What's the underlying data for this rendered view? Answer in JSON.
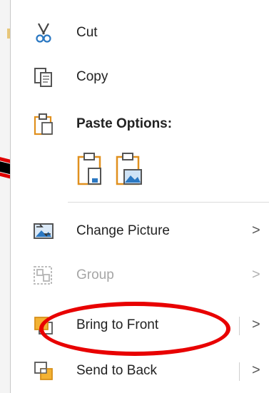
{
  "menu": {
    "cut": {
      "label": "Cut",
      "icon": "scissors-icon"
    },
    "copy": {
      "label": "Copy",
      "icon": "copy-icon"
    },
    "paste_options": {
      "label": "Paste Options:",
      "icon": "clipboard-icon"
    },
    "paste_buttons": [
      {
        "icon": "paste-keep-source-icon"
      },
      {
        "icon": "paste-picture-icon"
      }
    ],
    "change_picture": {
      "label": "Change Picture",
      "chevron": ">"
    },
    "group": {
      "label": "Group",
      "chevron": ">",
      "disabled": true
    },
    "bring_to_front": {
      "label": "Bring to Front",
      "chevron": ">"
    },
    "send_to_back": {
      "label": "Send to Back",
      "chevron": ">"
    }
  },
  "colors": {
    "highlight": "#e80000",
    "icon_orange": "#e0901e",
    "icon_blue": "#2b78c2"
  }
}
